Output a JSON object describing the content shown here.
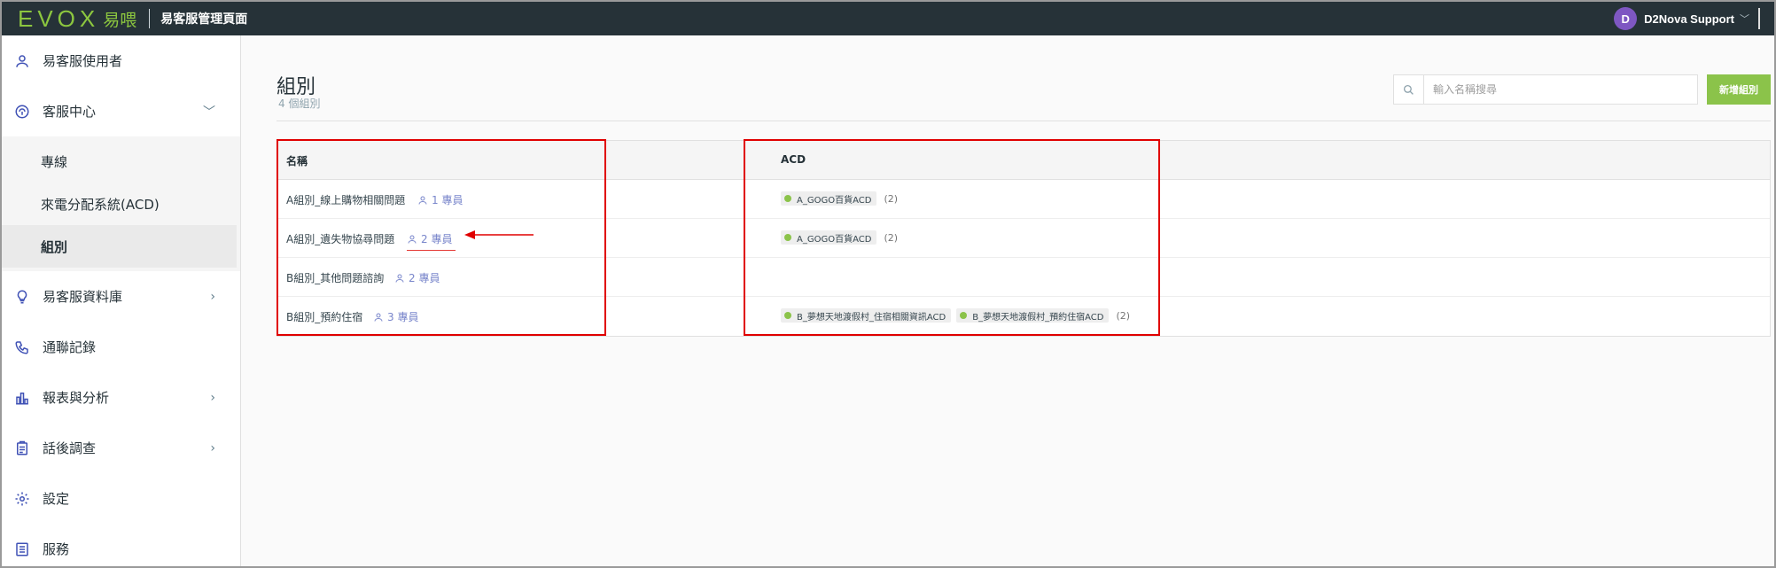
{
  "topbar": {
    "logo_text": "EVOX",
    "logo_cn": "易喂",
    "app_title": "易客服管理頁面",
    "user_initial": "D",
    "user_name": "D2Nova Support",
    "user_chevron": "﹀"
  },
  "sidebar": {
    "items": [
      {
        "label": "易客服使用者",
        "icon": "user-icon"
      },
      {
        "label": "客服中心",
        "icon": "headset-icon",
        "chevron": "﹀"
      },
      {
        "label": "易客服資料庫",
        "icon": "bulb-icon",
        "chevron": "›"
      },
      {
        "label": "通聯記錄",
        "icon": "phone-icon"
      },
      {
        "label": "報表與分析",
        "icon": "chart-icon",
        "chevron": "›"
      },
      {
        "label": "話後調查",
        "icon": "clipboard-icon",
        "chevron": "›"
      },
      {
        "label": "設定",
        "icon": "gear-icon"
      },
      {
        "label": "服務",
        "icon": "list-icon"
      }
    ],
    "sub_items": [
      {
        "label": "專線"
      },
      {
        "label": "來電分配系統(ACD)"
      },
      {
        "label": "組別",
        "active": true
      }
    ]
  },
  "main": {
    "title": "組別",
    "subtitle": "4 個組別",
    "search_placeholder": "輸入名稱搜尋",
    "add_button": "新增組別",
    "table": {
      "headers": {
        "name": "名稱",
        "acd": "ACD"
      },
      "rows": [
        {
          "name": "A組別_線上購物相關問題",
          "members": "1 專員",
          "acds": [
            "A_GOGO百貨ACD"
          ],
          "count": "(2)"
        },
        {
          "name": "A組別_遺失物協尋問題",
          "members": "2 專員",
          "acds": [
            "A_GOGO百貨ACD"
          ],
          "count": "(2)"
        },
        {
          "name": "B組別_其他問題諮詢",
          "members": "2 專員",
          "acds": [],
          "count": ""
        },
        {
          "name": "B組別_預約住宿",
          "members": "3 專員",
          "acds": [
            "B_夢想天地渡假村_住宿相關資訊ACD",
            "B_夢想天地渡假村_預約住宿ACD"
          ],
          "count": "(2)"
        }
      ]
    }
  },
  "colors": {
    "topbar": "#263238",
    "brand_green": "#8bc34a",
    "accent_indigo": "#3f51b5",
    "annotation_red": "#e00000"
  }
}
